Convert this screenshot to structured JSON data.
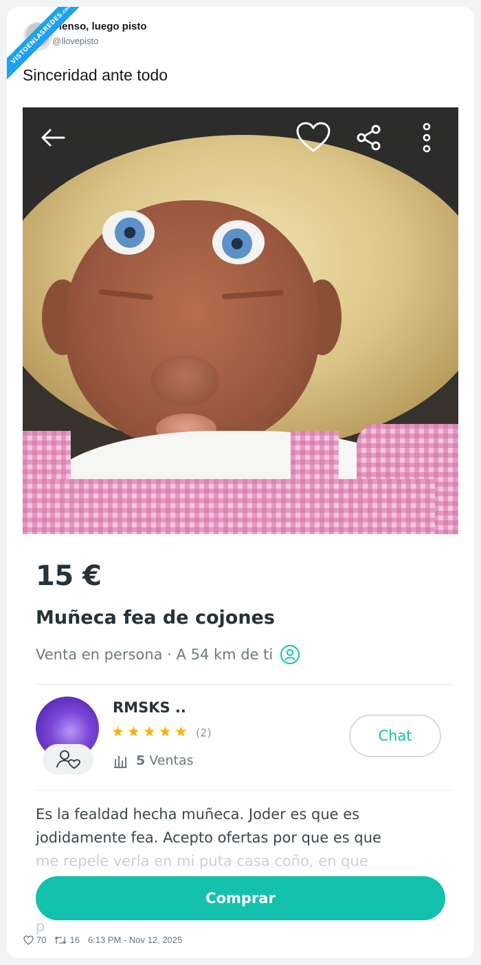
{
  "watermark": {
    "text": "VISTOENLASREDES",
    "suffix": ".com"
  },
  "tweet": {
    "author_name": "Pienso, luego pisto",
    "author_handle": "@llovepisto",
    "text": "Sinceridad ante todo",
    "likes": "70",
    "retweets": "16",
    "timestamp": "6:13 PM - Nov 12, 2025"
  },
  "listing": {
    "icons": [
      "back-arrow-icon",
      "heart-icon",
      "share-icon",
      "more-vertical-icon"
    ],
    "price": "15 €",
    "title": "Muñeca fea de cojones",
    "delivery": "Venta en persona · A 54 km de ti",
    "seller": {
      "name": "RMSKS ..",
      "rating_stars": 5,
      "review_count": "(2)",
      "sales_count": "5",
      "sales_label": "Ventas"
    },
    "chat_label": "Chat",
    "description_line1": "Es la fealdad hecha muñeca. Joder es que es",
    "description_line2": "jodidamente fea. Acepto ofertas por que es que",
    "description_line3": "me repele verla en mi puta casa coño, en que",
    "description_line4": "p",
    "buy_label": "Comprar",
    "colors": {
      "accent": "#13c1ac",
      "star": "#f5b301",
      "text": "#253238"
    }
  }
}
